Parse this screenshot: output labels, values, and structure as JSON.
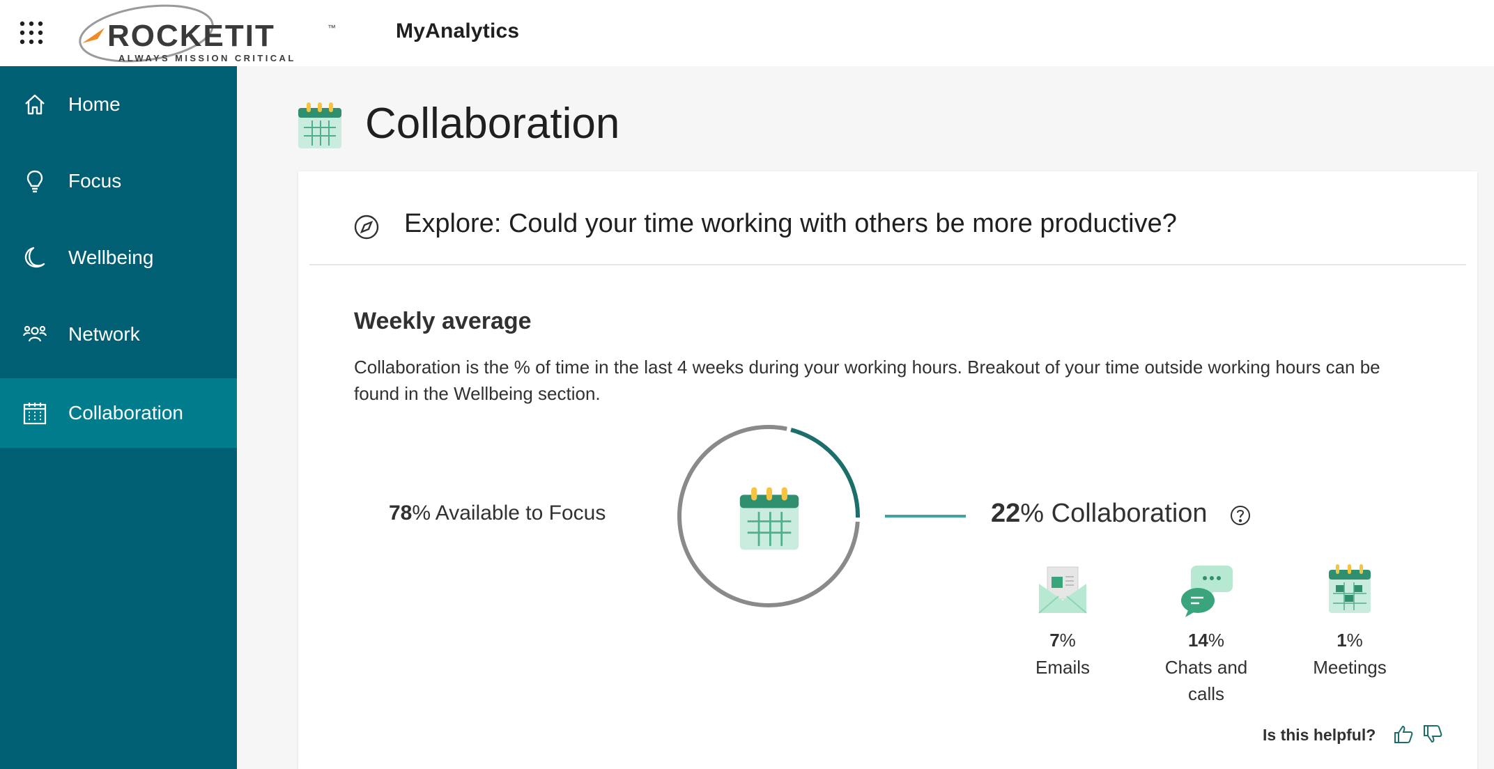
{
  "header": {
    "app_name": "MyAnalytics",
    "logo_text": "ROCKETIT",
    "logo_tagline": "ALWAYS MISSION CRITICAL",
    "logo_tm": "™"
  },
  "sidebar": {
    "items": [
      {
        "label": "Home",
        "icon": "home-icon"
      },
      {
        "label": "Focus",
        "icon": "lightbulb-icon"
      },
      {
        "label": "Wellbeing",
        "icon": "moon-icon"
      },
      {
        "label": "Network",
        "icon": "people-icon"
      },
      {
        "label": "Collaboration",
        "icon": "calendar-icon",
        "active": true
      }
    ]
  },
  "main": {
    "title": "Collaboration",
    "explore_text": "Explore: Could your time working with others be more productive?",
    "section_title": "Weekly average",
    "section_desc": "Collaboration is the % of time in the last 4 weeks during your working hours. Breakout of your time outside working hours can be found in the Wellbeing section.",
    "focus": {
      "value": "78",
      "suffix": "% Available to Focus"
    },
    "collaboration": {
      "value": "22",
      "suffix": "% Collaboration"
    },
    "breakdown": [
      {
        "value": "7",
        "unit": "%",
        "label": "Emails",
        "icon": "email-icon"
      },
      {
        "value": "14",
        "unit": "%",
        "label": "Chats and calls",
        "icon": "chat-icon"
      },
      {
        "value": "1",
        "unit": "%",
        "label": "Meetings",
        "icon": "meetings-icon"
      }
    ],
    "feedback_prompt": "Is this helpful?"
  },
  "colors": {
    "sidebar_bg": "#005f73",
    "sidebar_active": "#007c8c",
    "ring_focus": "#8a8a8a",
    "ring_collab": "#1c6e6a",
    "accent": "#3ea3a3"
  },
  "chart_data": {
    "type": "pie",
    "categories": [
      "Available to Focus",
      "Collaboration"
    ],
    "values": [
      78,
      22
    ]
  }
}
